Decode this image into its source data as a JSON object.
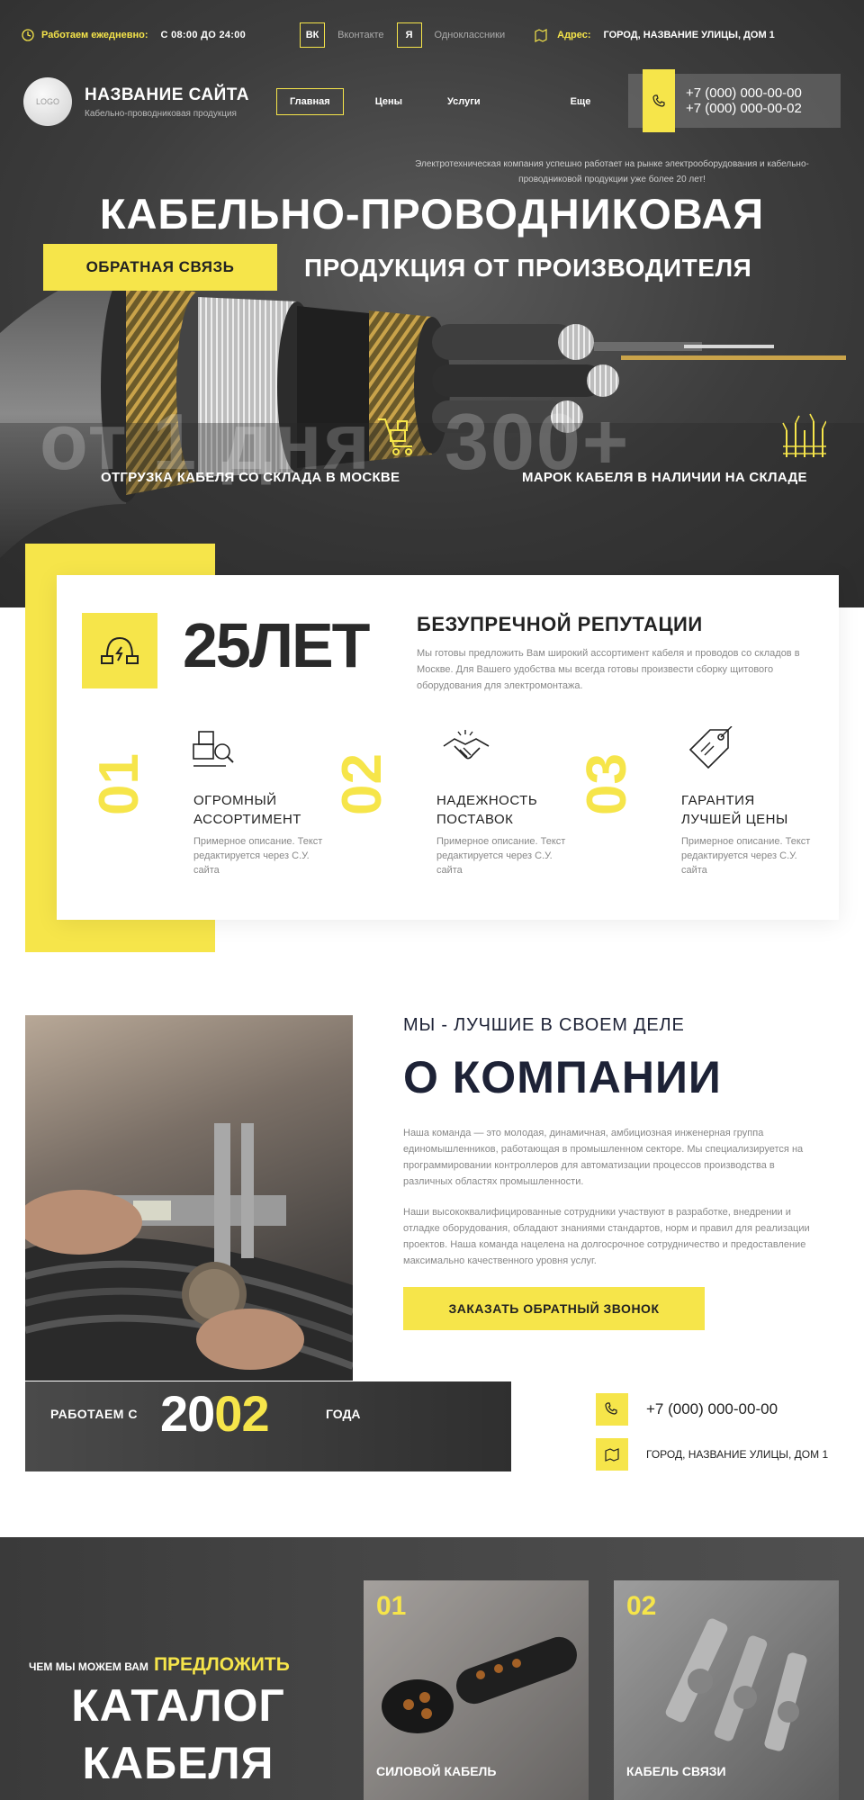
{
  "topbar": {
    "work_label": "Работаем ежедневно:",
    "work_value": "С 08:00 ДО 24:00",
    "vk_icon": "ВК",
    "vk_label": "Вконтакте",
    "ok_icon": "Я",
    "ok_label": "Одноклассники",
    "address_label": "Адрес:",
    "address_value": "ГОРОД, НАЗВАНИЕ УЛИЦЫ, ДОМ 1"
  },
  "header": {
    "logo_text": "LOGO",
    "site_name": "НАЗВАНИЕ САЙТА",
    "site_sub": "Кабельно-проводниковая продукция",
    "nav": [
      "Главная",
      "Цены",
      "Услуги",
      "Еще"
    ],
    "phone1": "+7 (000) 000-00-00",
    "phone2": "+7 (000) 000-00-02"
  },
  "hero": {
    "intro": "Электротехническая компания успешно работает на рынке электрооборудования и кабельно-проводниковой продукции уже более 20 лет!",
    "title": "КАБЕЛЬНО-ПРОВОДНИКОВАЯ",
    "subtitle": "ПРОДУКЦИЯ ОТ ПРОИЗВОДИТЕЛЯ",
    "button": "ОБРАТНАЯ СВЯЗЬ",
    "stat1_big": "от 1 дня",
    "stat1_text": "ОТГРУЗКА КАБЕЛЯ СО СКЛАДА В МОСКВЕ",
    "stat2_big": "300+",
    "stat2_text": "МАРОК КАБЕЛЯ В НАЛИЧИИ НА СКЛАДЕ"
  },
  "advantages": {
    "years": "25ЛЕТ",
    "rep_title": "БЕЗУПРЕЧНОЙ РЕПУТАЦИИ",
    "rep_text": "Мы готовы предложить Вам широкий ассортимент кабеля и проводов со складов в Москве. Для Вашего удобства мы всегда готовы произвести сборку щитового оборудования для электромонтажа.",
    "items": [
      {
        "num": "01",
        "title": "ОГРОМНЫЙ АССОРТИМЕНТ",
        "desc": "Примерное описание. Текст редактируется через С.У. сайта"
      },
      {
        "num": "02",
        "title": "НАДЕЖНОСТЬ ПОСТАВОК",
        "desc": "Примерное описание. Текст редактируется через С.У. сайта"
      },
      {
        "num": "03",
        "title": "ГАРАНТИЯ ЛУЧШЕЙ ЦЕНЫ",
        "desc": "Примерное описание. Текст редактируется через С.У. сайта"
      }
    ]
  },
  "about": {
    "kicker": "МЫ - ЛУЧШИЕ В СВОЕМ ДЕЛЕ",
    "title": "О КОМПАНИИ",
    "p1": "Наша команда — это молодая, динамичная, амбициозная инженерная группа единомышленников, работающая в промышленном секторе. Мы специализируется на программировании контроллеров для автоматизации процессов производства в различных областях промышленности.",
    "p2": "Наши высококвалифицированные сотрудники участвуют в разработке, внедрении и отладке оборудования, обладают знаниями стандартов, норм и правил для реализации проектов. Наша команда нацелена на долгосрочное сотрудничество и предоставление максимально качественного уровня услуг.",
    "button": "ЗАКАЗАТЬ ОБРАТНЫЙ ЗВОНОК",
    "since_label": "РАБОТАЕМ С",
    "since_year_a": "20",
    "since_year_b": "02",
    "since_suffix": "ГОДА",
    "phone": "+7 (000) 000-00-00",
    "address": "ГОРОД, НАЗВАНИЕ УЛИЦЫ, ДОМ 1"
  },
  "catalog": {
    "kicker": "ЧЕМ МЫ МОЖЕМ ВАМ",
    "kicker_hl": "ПРЕДЛОЖИТЬ",
    "title1": "КАТАЛОГ",
    "title2": "КАБЕЛЯ",
    "cards": [
      {
        "num": "01",
        "name": "СИЛОВОЙ КАБЕЛЬ"
      },
      {
        "num": "02",
        "name": "КАБЕЛЬ СВЯЗИ"
      }
    ]
  },
  "colors": {
    "accent": "#f6e54a",
    "dark": "#3a3a3a",
    "heading": "#1d2236"
  }
}
